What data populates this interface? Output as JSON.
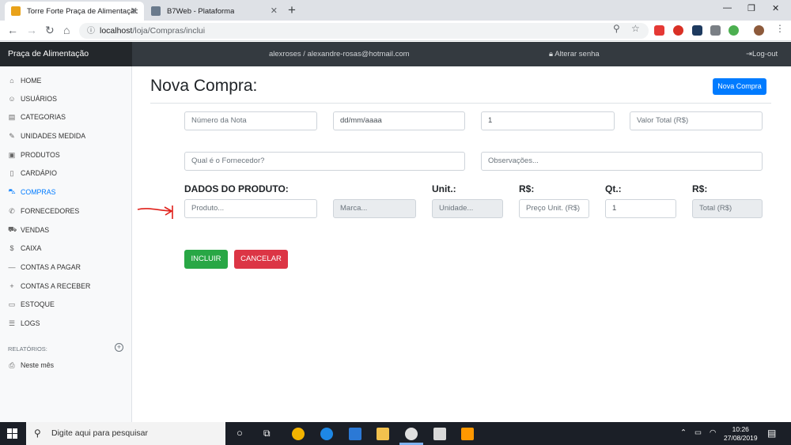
{
  "browser": {
    "tabs": [
      {
        "label": "Torre Forte Praça de Alimentação"
      },
      {
        "label": "B7Web - Plataforma"
      }
    ],
    "address": {
      "host": "localhost",
      "path": "/loja/Compras/inclui"
    }
  },
  "header": {
    "brand": "Praça de Alimentação",
    "user": "alexroses / alexandre-rosas@hotmail.com",
    "change_password": "Alterar senha",
    "logout": "Log-out"
  },
  "sidebar": {
    "items": [
      {
        "label": "HOME",
        "icon": "home-icon"
      },
      {
        "label": "USUÁRIOS",
        "icon": "users-icon"
      },
      {
        "label": "CATEGORIAS",
        "icon": "briefcase-icon"
      },
      {
        "label": "UNIDADES MEDIDA",
        "icon": "edit-icon"
      },
      {
        "label": "PRODUTOS",
        "icon": "box-icon"
      },
      {
        "label": "CARDÁPIO",
        "icon": "book-icon"
      },
      {
        "label": "COMPRAS",
        "icon": "cart-icon"
      },
      {
        "label": "FORNECEDORES",
        "icon": "phone-icon"
      },
      {
        "label": "VENDAS",
        "icon": "truck-icon"
      },
      {
        "label": "CAIXA",
        "icon": "dollar-icon"
      },
      {
        "label": "CONTAS A PAGAR",
        "icon": "minus-icon"
      },
      {
        "label": "CONTAS A RECEBER",
        "icon": "plus-icon"
      },
      {
        "label": "ESTOQUE",
        "icon": "clipboard-icon"
      },
      {
        "label": "LOGS",
        "icon": "list-icon"
      }
    ],
    "reports_heading": "RELATÓRIOS:",
    "reports": [
      {
        "label": "Neste mês",
        "icon": "printer-icon"
      }
    ]
  },
  "main": {
    "title": "Nova Compra:",
    "new_button": "Nova Compra",
    "form": {
      "nota_placeholder": "Número da Nota",
      "data_placeholder": "dd/mm/aaaa",
      "qty_value": "1",
      "valor_total_placeholder": "Valor Total (R$)",
      "fornecedor_placeholder": "Qual é o Fornecedor?",
      "observacoes_placeholder": "Observações..."
    },
    "product": {
      "heading": "DADOS DO PRODUTO:",
      "unit_heading": "Unit.:",
      "price_heading": "R$:",
      "qt_heading": "Qt.:",
      "total_heading": "R$:",
      "produto_placeholder": "Produto...",
      "marca_placeholder": "Marca...",
      "unidade_placeholder": "Unidade...",
      "preco_placeholder": "Preço Unit. (R$)",
      "qt_value": "1",
      "total_placeholder": "Total (R$)"
    },
    "buttons": {
      "include": "INCLUIR",
      "cancel": "CANCELAR"
    }
  },
  "taskbar": {
    "search_placeholder": "Digite aqui para pesquisar",
    "time": "10:26",
    "date": "27/08/2019"
  },
  "colors": {
    "primary": "#007bff",
    "success": "#28a745",
    "danger": "#dc3545",
    "navbar": "#343a40",
    "annotation": "#e0201a"
  }
}
